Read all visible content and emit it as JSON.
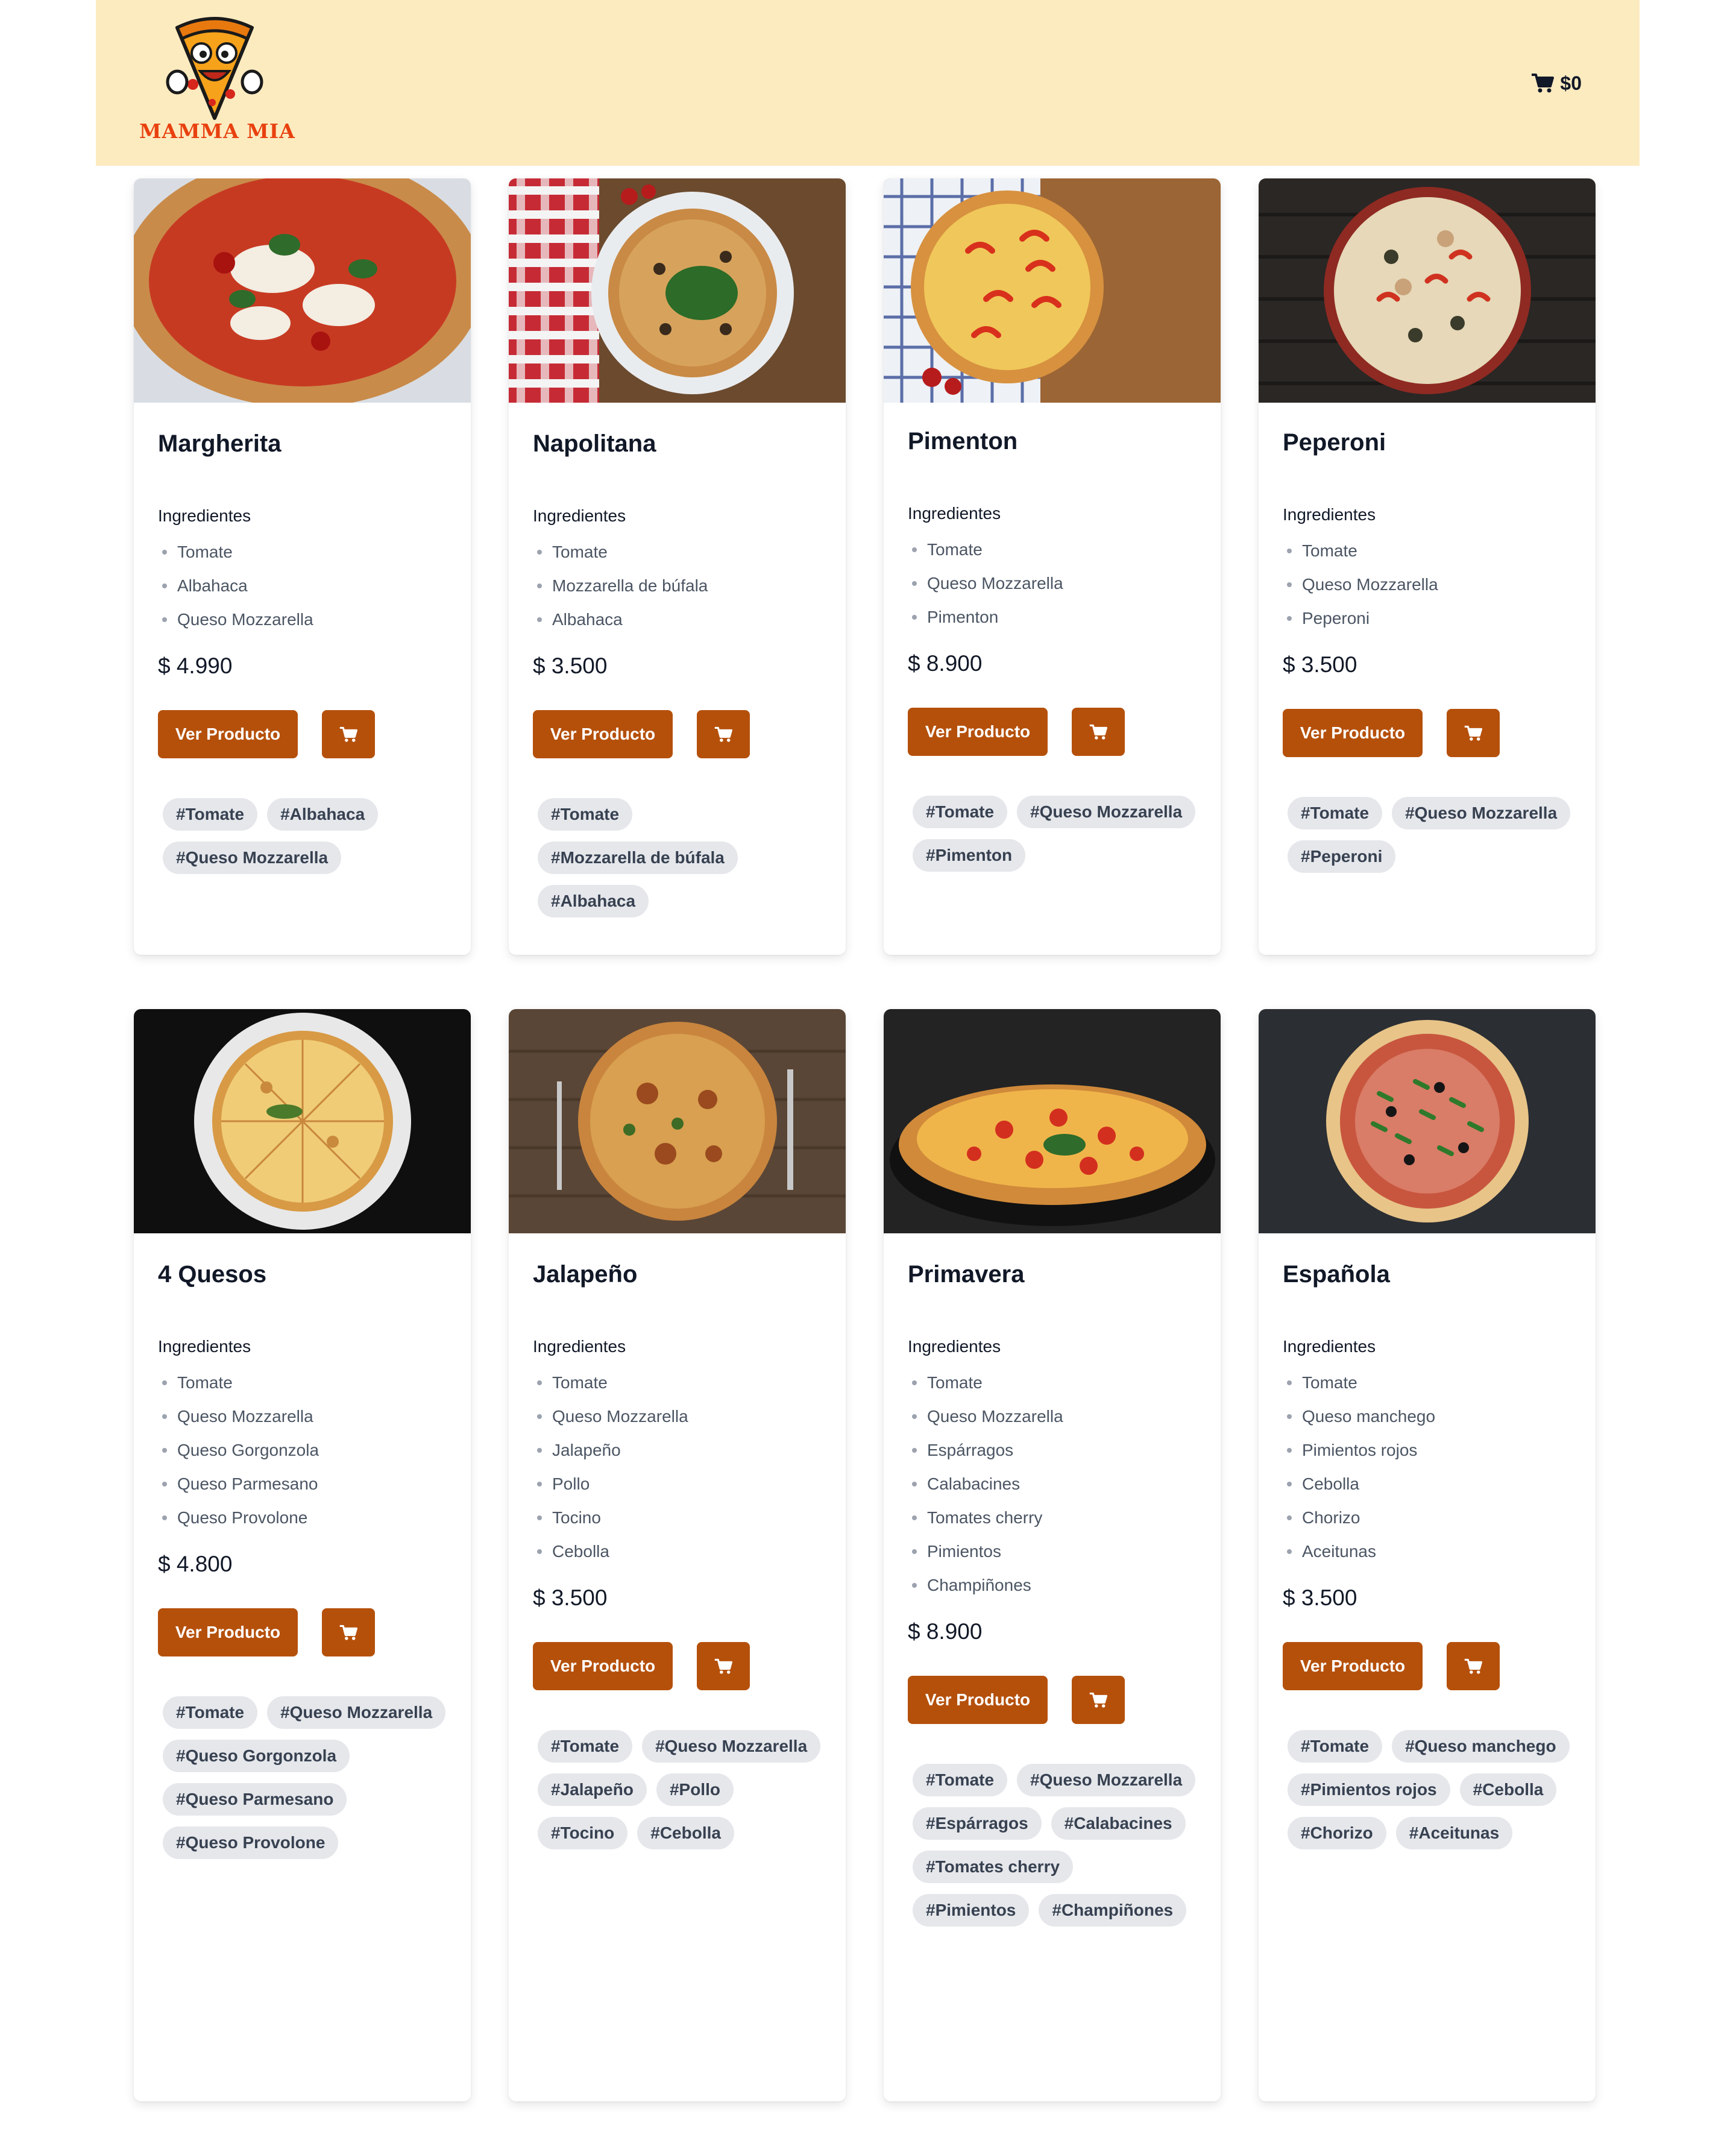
{
  "brand": {
    "name": "MAMMA MIA",
    "logo_icon": "pizza-mascot-icon",
    "brand_color": "#e8410f"
  },
  "cart": {
    "icon": "cart-icon",
    "total": "$0"
  },
  "colors": {
    "header_bg": "#fdebc0",
    "button": "#b5500b",
    "tag_bg": "#e5e7eb"
  },
  "labels": {
    "ingredients": "Ingredientes",
    "view_button": "Ver Producto",
    "add_cart_icon": "cart-icon"
  },
  "pizzas": [
    {
      "name": "Margherita",
      "price": "$ 4.990",
      "ingredients": [
        "Tomate",
        "Albahaca",
        "Queso Mozzarella"
      ],
      "tags": [
        "#Tomate",
        "#Albahaca",
        "#Queso Mozzarella"
      ]
    },
    {
      "name": "Napolitana",
      "price": "$ 3.500",
      "ingredients": [
        "Tomate",
        "Mozzarella de búfala",
        "Albahaca"
      ],
      "tags": [
        "#Tomate",
        "#Mozzarella de búfala",
        "#Albahaca"
      ]
    },
    {
      "name": "Pimenton",
      "price": "$ 8.900",
      "ingredients": [
        "Tomate",
        "Queso Mozzarella",
        "Pimenton"
      ],
      "tags": [
        "#Tomate",
        "#Queso Mozzarella",
        "#Pimenton"
      ]
    },
    {
      "name": "Peperoni",
      "price": "$ 3.500",
      "ingredients": [
        "Tomate",
        "Queso Mozzarella",
        "Peperoni"
      ],
      "tags": [
        "#Tomate",
        "#Queso Mozzarella",
        "#Peperoni"
      ]
    },
    {
      "name": "4 Quesos",
      "price": "$ 4.800",
      "ingredients": [
        "Tomate",
        "Queso Mozzarella",
        "Queso Gorgonzola",
        "Queso Parmesano",
        "Queso Provolone"
      ],
      "tags": [
        "#Tomate",
        "#Queso Mozzarella",
        "#Queso Gorgonzola",
        "#Queso Parmesano",
        "#Queso Provolone"
      ]
    },
    {
      "name": "Jalapeño",
      "price": "$ 3.500",
      "ingredients": [
        "Tomate",
        "Queso Mozzarella",
        "Jalapeño",
        "Pollo",
        "Tocino",
        "Cebolla"
      ],
      "tags": [
        "#Tomate",
        "#Queso Mozzarella",
        "#Jalapeño",
        "#Pollo",
        "#Tocino",
        "#Cebolla"
      ]
    },
    {
      "name": "Primavera",
      "price": "$ 8.900",
      "ingredients": [
        "Tomate",
        "Queso Mozzarella",
        "Espárragos",
        "Calabacines",
        "Tomates cherry",
        "Pimientos",
        "Champiñones"
      ],
      "tags": [
        "#Tomate",
        "#Queso Mozzarella",
        "#Espárragos",
        "#Calabacines",
        "#Tomates cherry",
        "#Pimientos",
        "#Champiñones"
      ]
    },
    {
      "name": "Española",
      "price": "$ 3.500",
      "ingredients": [
        "Tomate",
        "Queso manchego",
        "Pimientos rojos",
        "Cebolla",
        "Chorizo",
        "Aceitunas"
      ],
      "tags": [
        "#Tomate",
        "#Queso manchego",
        "#Pimientos rojos",
        "#Cebolla",
        "#Chorizo",
        "#Aceitunas"
      ]
    }
  ]
}
